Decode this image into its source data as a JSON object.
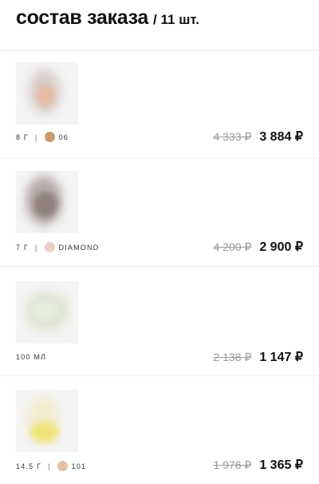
{
  "header": {
    "title": "состав заказа",
    "count": "/ 11 шт."
  },
  "items": [
    {
      "meta_size": "8 Г",
      "separator": "|",
      "shade": "06",
      "shade_color": "#c99a6b",
      "old_price": "4 333 ₽",
      "price": "3 884 ₽"
    },
    {
      "meta_size": "7 Г",
      "separator": "|",
      "shade": "DIAMOND",
      "shade_color": "#ecd0c4",
      "old_price": "4 200 ₽",
      "price": "2 900 ₽"
    },
    {
      "meta_size": "100 МЛ",
      "old_price": "2 138 ₽",
      "price": "1 147 ₽"
    },
    {
      "meta_size": "14.5 Г",
      "separator": "|",
      "shade": "101",
      "shade_color": "#e3c3a6",
      "old_price": "1 976 ₽",
      "price": "1 365 ₽"
    }
  ]
}
